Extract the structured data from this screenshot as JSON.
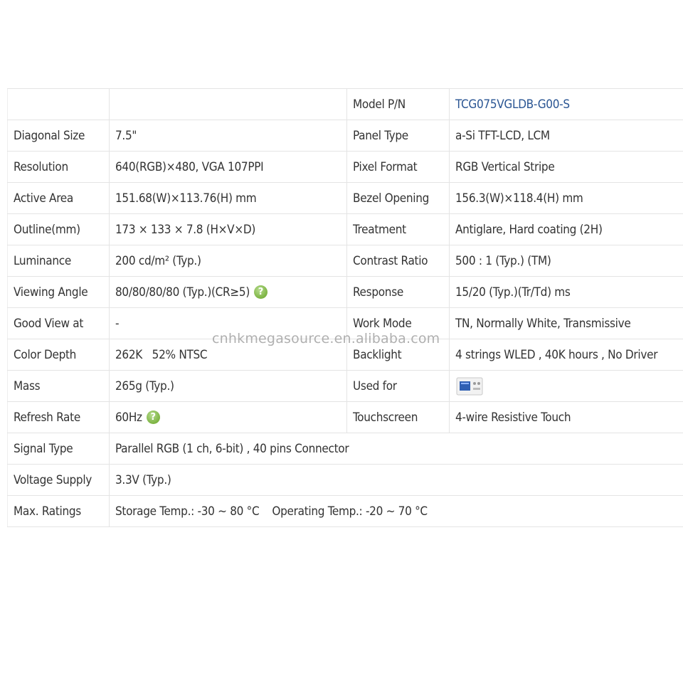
{
  "watermark": "cnhkmegasource.en.alibaba.com",
  "model": {
    "label": "Model P/N",
    "value": "TCG075VGLDB-G00-S"
  },
  "rows": [
    {
      "l1": "Diagonal Size",
      "v1": "7.5\"",
      "l2": "Panel Type",
      "v2": "a-Si TFT-LCD, LCM"
    },
    {
      "l1": "Resolution",
      "v1": "640(RGB)×480, VGA  107PPI",
      "l2": "Pixel Format",
      "v2": "RGB Vertical Stripe"
    },
    {
      "l1": "Active Area",
      "v1": "151.68(W)×113.76(H) mm",
      "l2": "Bezel Opening",
      "v2": "156.3(W)×118.4(H) mm"
    },
    {
      "l1": "Outline(mm)",
      "v1": "173 × 133 × 7.8 (H×V×D)",
      "l2": "Treatment",
      "v2": "Antiglare, Hard coating (2H)"
    },
    {
      "l1": "Luminance",
      "v1": "200 cd/m² (Typ.)",
      "l2": "Contrast Ratio",
      "v2": "500 : 1 (Typ.) (TM)"
    },
    {
      "l1": "Viewing Angle",
      "v1": "80/80/80/80 (Typ.)(CR≥5)",
      "l2": "Response",
      "v2": "15/20 (Typ.)(Tr/Td) ms"
    },
    {
      "l1": "Good View at",
      "v1": "-",
      "l2": "Work Mode",
      "v2": "TN, Normally White, Transmissive"
    },
    {
      "l1": "Color Depth",
      "v1": "262K   52% NTSC",
      "l2": "Backlight",
      "v2": "4 strings WLED , 40K hours , No Driver"
    },
    {
      "l1": "Mass",
      "v1": "265g (Typ.)",
      "l2": "Used for",
      "v2": ""
    },
    {
      "l1": "Refresh Rate",
      "v1": "60Hz",
      "l2": "Touchscreen",
      "v2": "4-wire Resistive Touch"
    }
  ],
  "wide_rows": [
    {
      "label": "Signal Type",
      "value": "Parallel RGB (1 ch, 6-bit) , 40 pins Connector"
    },
    {
      "label": "Voltage Supply",
      "value": "3.3V (Typ.)"
    },
    {
      "label": "Max. Ratings",
      "storage": "Storage Temp.: -30 ~ 80 °C",
      "operating": "Operating Temp.: -20 ~ 70 °C"
    }
  ],
  "icons": {
    "help_glyph": "?",
    "help_color": "#7cb342",
    "used_for_icon": "instrument-device-icon"
  }
}
